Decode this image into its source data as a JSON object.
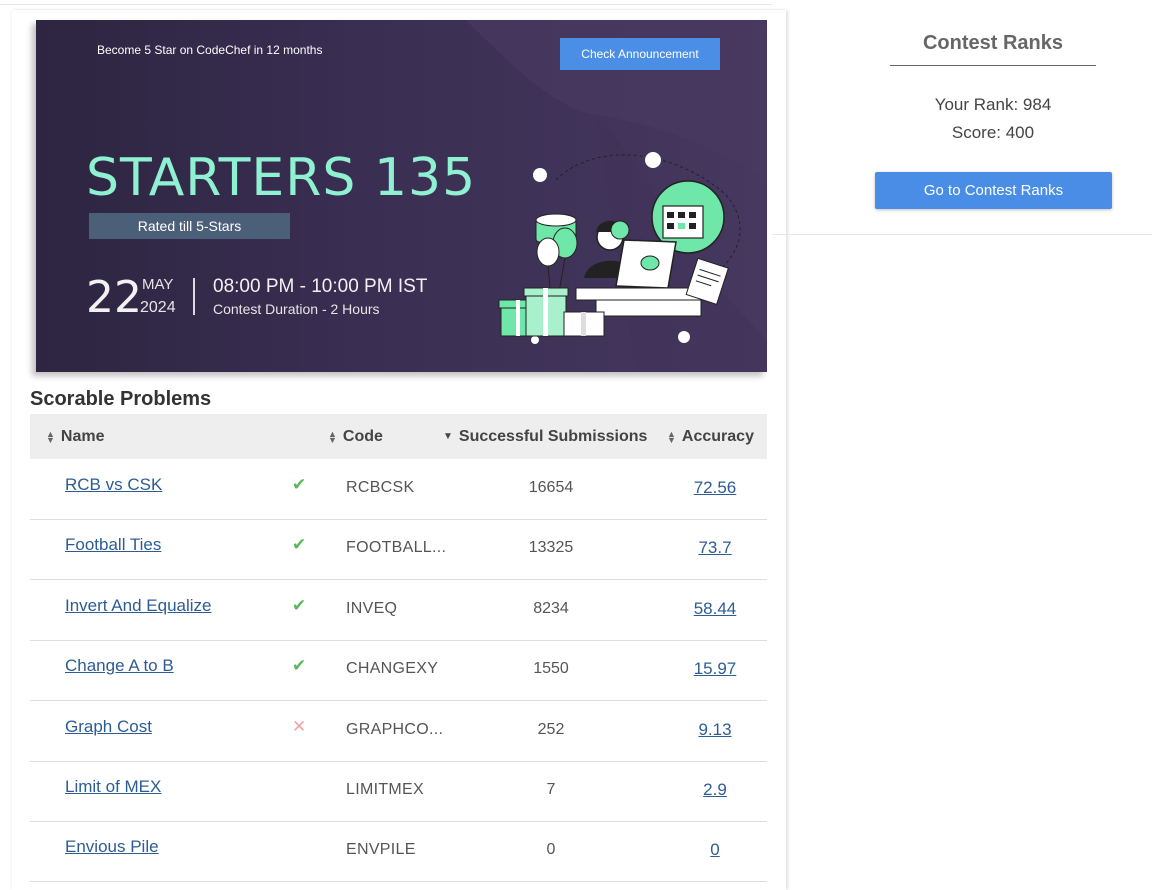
{
  "banner": {
    "tagline": "Become 5 Star on CodeChef in 12 months",
    "announcement_button": "Check Announcement",
    "title": "STARTERS 135",
    "rated": "Rated till 5-Stars",
    "day": "22",
    "month": "MAY",
    "year": "2024",
    "time": "08:00 PM - 10:00 PM IST",
    "duration": "Contest Duration - 2  Hours",
    "colors": {
      "background": "#3a2e52",
      "title": "#8ff0d2",
      "accent": "#4b8ee6",
      "illustration_green": "#6ee7a8"
    }
  },
  "problems": {
    "section_title": "Scorable Problems",
    "columns": {
      "name": "Name",
      "code": "Code",
      "submissions": "Successful Submissions",
      "accuracy": "Accuracy"
    },
    "rows": [
      {
        "name": "RCB vs CSK",
        "status": "solved",
        "status_glyph": "✔",
        "code": "RCBCSK",
        "submissions": "16654",
        "accuracy": "72.56"
      },
      {
        "name": "Football Ties",
        "status": "solved",
        "status_glyph": "✔",
        "code": "FOOTBALL...",
        "submissions": "13325",
        "accuracy": "73.7"
      },
      {
        "name": "Invert And Equalize",
        "status": "solved",
        "status_glyph": "✔",
        "code": "INVEQ",
        "submissions": "8234",
        "accuracy": "58.44"
      },
      {
        "name": "Change A to B",
        "status": "solved",
        "status_glyph": "✔",
        "code": "CHANGEXY",
        "submissions": "1550",
        "accuracy": "15.97"
      },
      {
        "name": "Graph Cost",
        "status": "wrong",
        "status_glyph": "✕",
        "code": "GRAPHCO...",
        "submissions": "252",
        "accuracy": "9.13"
      },
      {
        "name": "Limit of MEX",
        "status": "none",
        "status_glyph": "",
        "code": "LIMITMEX",
        "submissions": "7",
        "accuracy": "2.9"
      },
      {
        "name": "Envious Pile",
        "status": "none",
        "status_glyph": "",
        "code": "ENVPILE",
        "submissions": "0",
        "accuracy": "0"
      }
    ],
    "status_colors": {
      "solved": "#5cb85c",
      "wrong": "#f2a3a3"
    }
  },
  "ranks": {
    "title": "Contest Ranks",
    "your_rank": "Your Rank: 984",
    "score": "Score: 400",
    "button": "Go to Contest Ranks"
  }
}
